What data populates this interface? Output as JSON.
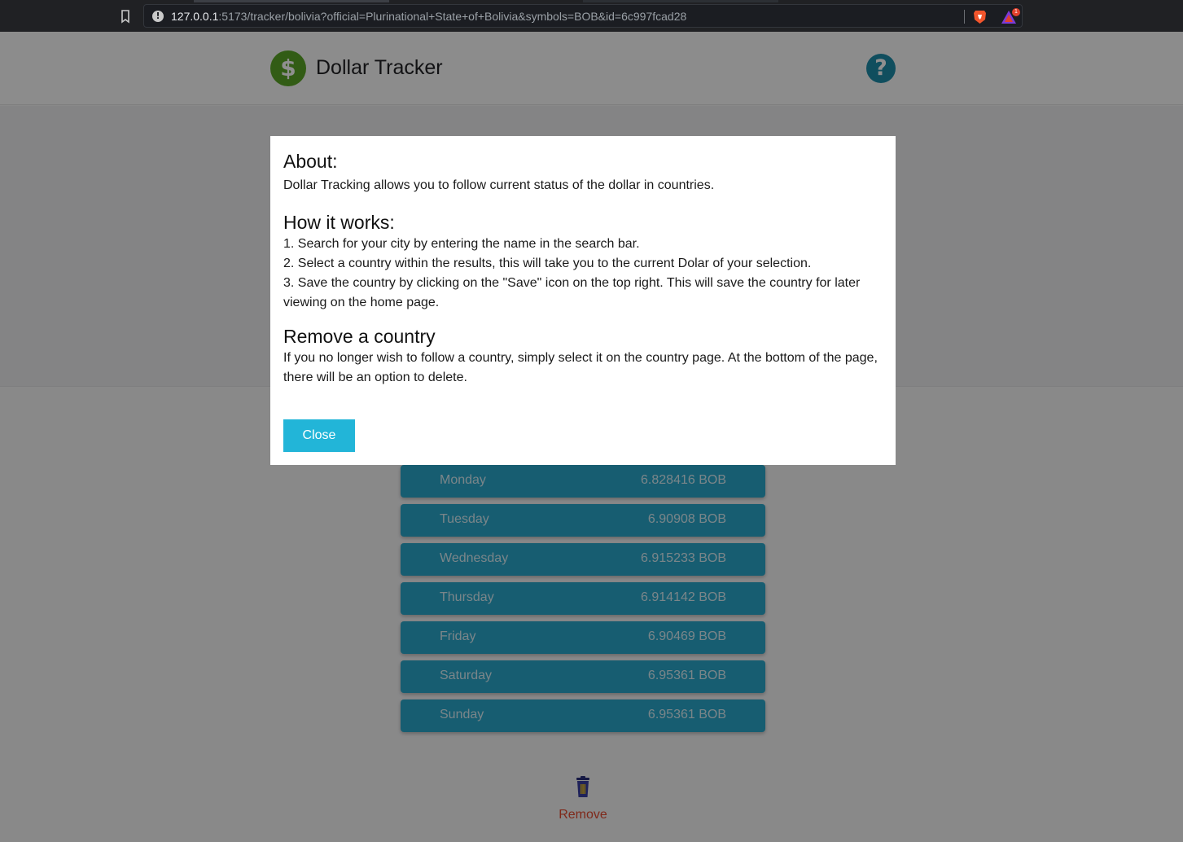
{
  "browser": {
    "url_host": "127.0.0.1",
    "url_path": ":5173/tracker/bolivia?official=Plurinational+State+of+Bolivia&symbols=BOB&id=6c997fcad28",
    "rewards_badge": "1"
  },
  "header": {
    "logo_symbol": "$",
    "title": "Dollar Tracker",
    "help_symbol": "?"
  },
  "modal": {
    "about_title": "About:",
    "about_text": "Dollar Tracking allows you to follow current status of the dollar in countries.",
    "how_title": "How it works:",
    "steps": [
      "1. Search for your city by entering the name in the search bar.",
      "2. Select a country within the results, this will take you to the current Dolar of your selection.",
      "3. Save the country by clicking on the \"Save\" icon on the top right. This will save the country for later viewing on the home page."
    ],
    "remove_title": "Remove a country",
    "remove_text": "If you no longer wish to follow a country, simply select it on the country page. At the bottom of the page, there will be an option to delete.",
    "close_label": "Close"
  },
  "days": [
    {
      "day": "Monday",
      "value": "6.828416 BOB"
    },
    {
      "day": "Tuesday",
      "value": "6.90908 BOB"
    },
    {
      "day": "Wednesday",
      "value": "6.915233 BOB"
    },
    {
      "day": "Thursday",
      "value": "6.914142 BOB"
    },
    {
      "day": "Friday",
      "value": "6.90469 BOB"
    },
    {
      "day": "Saturday",
      "value": "6.95361 BOB"
    },
    {
      "day": "Sunday",
      "value": "6.95361 BOB"
    }
  ],
  "remove": {
    "label": "Remove"
  },
  "colors": {
    "accent": "#22b5d8",
    "logo_green": "#5aa526",
    "help_blue": "#1e8ba8",
    "remove_red": "#e2492f",
    "row_blue": "#2aa6c9"
  }
}
